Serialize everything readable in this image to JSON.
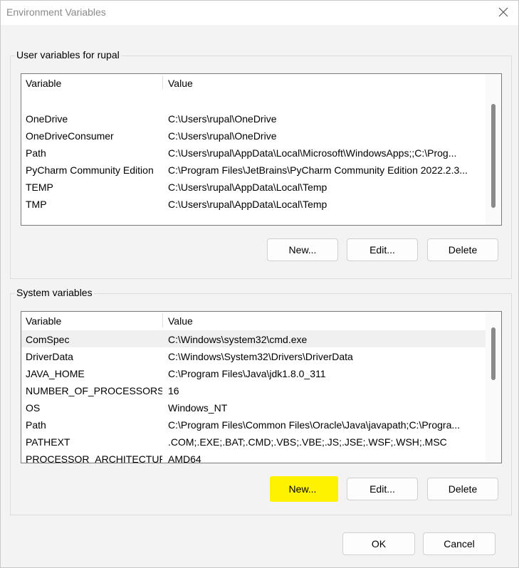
{
  "window": {
    "title": "Environment Variables",
    "close_icon": "close-icon"
  },
  "user_section": {
    "label": "User variables for rupal",
    "columns": {
      "variable": "Variable",
      "value": "Value"
    },
    "rows": [
      {
        "variable": "OneDrive",
        "value": "C:\\Users\\rupal\\OneDrive"
      },
      {
        "variable": "OneDriveConsumer",
        "value": "C:\\Users\\rupal\\OneDrive"
      },
      {
        "variable": "Path",
        "value": "C:\\Users\\rupal\\AppData\\Local\\Microsoft\\WindowsApps;;C:\\Prog..."
      },
      {
        "variable": "PyCharm Community Edition",
        "value": "C:\\Program Files\\JetBrains\\PyCharm Community Edition 2022.2.3..."
      },
      {
        "variable": "TEMP",
        "value": "C:\\Users\\rupal\\AppData\\Local\\Temp"
      },
      {
        "variable": "TMP",
        "value": "C:\\Users\\rupal\\AppData\\Local\\Temp"
      }
    ],
    "buttons": {
      "new": "New...",
      "edit": "Edit...",
      "delete": "Delete"
    }
  },
  "system_section": {
    "label": "System variables",
    "columns": {
      "variable": "Variable",
      "value": "Value"
    },
    "rows": [
      {
        "variable": "ComSpec",
        "value": "C:\\Windows\\system32\\cmd.exe"
      },
      {
        "variable": "DriverData",
        "value": "C:\\Windows\\System32\\Drivers\\DriverData"
      },
      {
        "variable": "JAVA_HOME",
        "value": "C:\\Program Files\\Java\\jdk1.8.0_311"
      },
      {
        "variable": "NUMBER_OF_PROCESSORS",
        "value": "16"
      },
      {
        "variable": "OS",
        "value": "Windows_NT"
      },
      {
        "variable": "Path",
        "value": "C:\\Program Files\\Common Files\\Oracle\\Java\\javapath;C:\\Progra..."
      },
      {
        "variable": "PATHEXT",
        "value": ".COM;.EXE;.BAT;.CMD;.VBS;.VBE;.JS;.JSE;.WSF;.WSH;.MSC"
      },
      {
        "variable": "PROCESSOR_ARCHITECTURE",
        "value": "AMD64"
      }
    ],
    "buttons": {
      "new": "New...",
      "edit": "Edit...",
      "delete": "Delete"
    }
  },
  "dialog_buttons": {
    "ok": "OK",
    "cancel": "Cancel"
  },
  "colors": {
    "highlight": "#fff200",
    "selected_row": "#f0f0f0"
  }
}
